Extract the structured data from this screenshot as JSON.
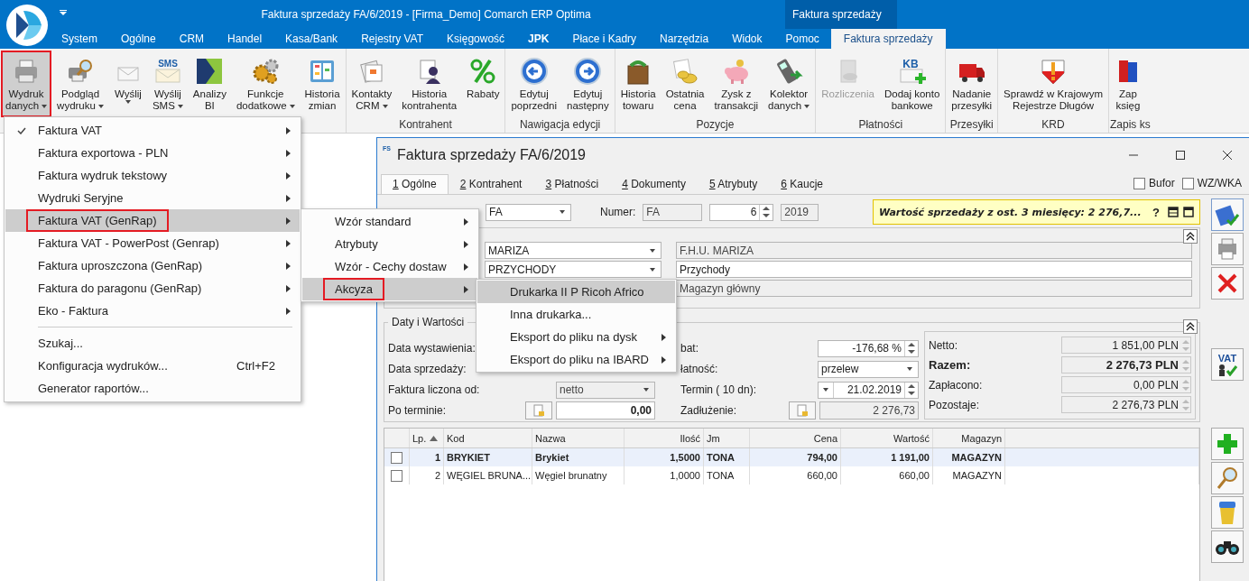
{
  "app": {
    "title": "Faktura sprzedaży FA/6/2019 - [Firma_Demo] Comarch ERP Optima",
    "context_header": "Faktura sprzedaży"
  },
  "menu_tabs": [
    {
      "label": "System",
      "selected": false,
      "bold": false
    },
    {
      "label": "Ogólne",
      "selected": false,
      "bold": false
    },
    {
      "label": "CRM",
      "selected": false,
      "bold": false
    },
    {
      "label": "Handel",
      "selected": false,
      "bold": false
    },
    {
      "label": "Kasa/Bank",
      "selected": false,
      "bold": false
    },
    {
      "label": "Rejestry VAT",
      "selected": false,
      "bold": false
    },
    {
      "label": "Księgowość",
      "selected": false,
      "bold": false
    },
    {
      "label": "JPK",
      "selected": false,
      "bold": true
    },
    {
      "label": "Płace i Kadry",
      "selected": false,
      "bold": false
    },
    {
      "label": "Narzędzia",
      "selected": false,
      "bold": false
    },
    {
      "label": "Widok",
      "selected": false,
      "bold": false
    },
    {
      "label": "Pomoc",
      "selected": false,
      "bold": false
    },
    {
      "label": "Faktura sprzedaży",
      "selected": true,
      "bold": false
    }
  ],
  "ribbon_groups": [
    {
      "buttons": [
        {
          "lines": [
            "Wydruk",
            "danych"
          ],
          "dropdown": true,
          "pressed": true,
          "marked": true,
          "disabled": false
        },
        {
          "lines": [
            "Podgląd",
            "wydruku"
          ],
          "dropdown": true,
          "pressed": false,
          "marked": false,
          "disabled": false
        },
        {
          "lines": [
            "Wyślij"
          ],
          "dropdown": true,
          "pressed": false,
          "marked": false,
          "disabled": false
        },
        {
          "lines": [
            "Wyślij",
            "SMS"
          ],
          "dropdown": true,
          "pressed": false,
          "marked": false,
          "disabled": false,
          "icon_text": "SMS"
        },
        {
          "lines": [
            "Analizy",
            "BI"
          ],
          "dropdown": false,
          "pressed": false,
          "marked": false,
          "disabled": false
        },
        {
          "lines": [
            "Funkcje",
            "dodatkowe"
          ],
          "dropdown": true,
          "pressed": false,
          "marked": false,
          "disabled": false
        },
        {
          "lines": [
            "Historia",
            "zmian"
          ],
          "dropdown": false,
          "pressed": false,
          "marked": false,
          "disabled": false
        }
      ]
    },
    {
      "label": "Kontrahent",
      "buttons": [
        {
          "lines": [
            "Kontakty",
            "CRM"
          ],
          "dropdown": true,
          "pressed": false,
          "marked": false,
          "disabled": false
        },
        {
          "lines": [
            "Historia",
            "kontrahenta"
          ],
          "dropdown": false,
          "pressed": false,
          "marked": false,
          "disabled": false
        },
        {
          "lines": [
            "Rabaty"
          ],
          "dropdown": false,
          "pressed": false,
          "marked": false,
          "disabled": false
        }
      ]
    },
    {
      "label": "Nawigacja edycji",
      "buttons": [
        {
          "lines": [
            "Edytuj",
            "poprzedni"
          ],
          "dropdown": false,
          "pressed": false,
          "marked": false,
          "disabled": false
        },
        {
          "lines": [
            "Edytuj",
            "następny"
          ],
          "dropdown": false,
          "pressed": false,
          "marked": false,
          "disabled": false
        }
      ]
    },
    {
      "label": "Pozycje",
      "buttons": [
        {
          "lines": [
            "Historia",
            "towaru"
          ],
          "dropdown": false,
          "pressed": false,
          "marked": false,
          "disabled": false
        },
        {
          "lines": [
            "Ostatnia",
            "cena"
          ],
          "dropdown": false,
          "pressed": false,
          "marked": false,
          "disabled": false
        },
        {
          "lines": [
            "Zysk z",
            "transakcji"
          ],
          "dropdown": false,
          "pressed": false,
          "marked": false,
          "disabled": false
        },
        {
          "lines": [
            "Kolektor",
            "danych"
          ],
          "dropdown": true,
          "pressed": false,
          "marked": false,
          "disabled": false
        }
      ]
    },
    {
      "label": "Płatności",
      "buttons": [
        {
          "lines": [
            "Rozliczenia"
          ],
          "dropdown": false,
          "pressed": false,
          "marked": false,
          "disabled": true
        },
        {
          "lines": [
            "Dodaj konto",
            "bankowe"
          ],
          "dropdown": false,
          "pressed": false,
          "marked": false,
          "disabled": false,
          "icon_text": "KB"
        }
      ]
    },
    {
      "label": "Przesyłki",
      "buttons": [
        {
          "lines": [
            "Nadanie",
            "przesyłki"
          ],
          "dropdown": false,
          "pressed": false,
          "marked": false,
          "disabled": false
        }
      ]
    },
    {
      "label": "KRD",
      "buttons": [
        {
          "lines": [
            "Sprawdź w Krajowym",
            "Rejestrze Długów"
          ],
          "dropdown": false,
          "pressed": false,
          "marked": false,
          "disabled": false
        }
      ]
    },
    {
      "label": "Zapis ks",
      "buttons": [
        {
          "lines": [
            "Zap",
            "księg"
          ],
          "dropdown": false,
          "pressed": false,
          "marked": false,
          "disabled": false
        }
      ]
    }
  ],
  "print_menu": [
    {
      "kind": "item",
      "label": "Faktura VAT",
      "checked": true,
      "arrow": true,
      "selected": false,
      "marked": false
    },
    {
      "kind": "item",
      "label": "Faktura exportowa - PLN",
      "checked": false,
      "arrow": true,
      "selected": false,
      "marked": false
    },
    {
      "kind": "item",
      "label": "Faktura wydruk tekstowy",
      "checked": false,
      "arrow": true,
      "selected": false,
      "marked": false
    },
    {
      "kind": "item",
      "label": "Wydruki Seryjne",
      "checked": false,
      "arrow": true,
      "selected": false,
      "marked": false
    },
    {
      "kind": "item",
      "label": "Faktura VAT (GenRap)",
      "checked": false,
      "arrow": true,
      "selected": true,
      "marked": true
    },
    {
      "kind": "item",
      "label": "Faktura VAT - PowerPost (Genrap)",
      "checked": false,
      "arrow": true,
      "selected": false,
      "marked": false
    },
    {
      "kind": "item",
      "label": "Faktura uproszczona (GenRap)",
      "checked": false,
      "arrow": true,
      "selected": false,
      "marked": false
    },
    {
      "kind": "item",
      "label": "Faktura do paragonu (GenRap)",
      "checked": false,
      "arrow": true,
      "selected": false,
      "marked": false
    },
    {
      "kind": "item",
      "label": "Eko - Faktura",
      "checked": false,
      "arrow": true,
      "selected": false,
      "marked": false
    },
    {
      "kind": "separator"
    },
    {
      "kind": "item",
      "label": "Szukaj...",
      "checked": false,
      "arrow": false,
      "selected": false,
      "marked": false
    },
    {
      "kind": "item",
      "label": "Konfiguracja wydruków...",
      "shortcut": "Ctrl+F2",
      "checked": false,
      "arrow": false,
      "selected": false,
      "marked": false
    },
    {
      "kind": "item",
      "label": "Generator raportów...",
      "checked": false,
      "arrow": false,
      "selected": false,
      "marked": false
    }
  ],
  "submenu": [
    {
      "label": "Wzór standard",
      "arrow": true,
      "selected": false,
      "marked": false
    },
    {
      "label": "Atrybuty",
      "arrow": true,
      "selected": false,
      "marked": false
    },
    {
      "label": "Wzór - Cechy dostaw",
      "arrow": true,
      "selected": false,
      "marked": false
    },
    {
      "label": "Akcyza",
      "arrow": true,
      "selected": true,
      "marked": true
    }
  ],
  "submenu_2": [
    {
      "label": "Drukarka II P Ricoh Africo",
      "arrow": false,
      "selected": true
    },
    {
      "label": "Inna drukarka...",
      "arrow": false,
      "selected": false
    },
    {
      "label": "Eksport do pliku na dysk",
      "arrow": true,
      "selected": false
    },
    {
      "label": "Eksport do pliku na IBARD",
      "arrow": true,
      "selected": false
    }
  ],
  "document": {
    "icon_text": "FS",
    "title": "Faktura sprzedaży FA/6/2019",
    "tabs": [
      {
        "key": "1",
        "label": "Ogólne",
        "selected": true
      },
      {
        "key": "2",
        "label": "Kontrahent",
        "selected": false
      },
      {
        "key": "3",
        "label": "Płatności",
        "selected": false
      },
      {
        "key": "4",
        "label": "Dokumenty",
        "selected": false
      },
      {
        "key": "5",
        "label": "Atrybuty",
        "selected": false
      },
      {
        "key": "6",
        "label": "Kaucje",
        "selected": false
      }
    ],
    "options": [
      {
        "label": "Bufor",
        "checked": false
      },
      {
        "label": "WZ/WKA",
        "checked": false
      }
    ],
    "header": {
      "document_type": "FA",
      "number_label": "Numer:",
      "series": "FA",
      "number": "6",
      "year": "2019",
      "info": "Wartość sprzedaży z ost. 3 miesięcy: 2 276,7...",
      "info_help": "?"
    },
    "parties": [
      {
        "code": "MARIZA",
        "name": "F.H.U. MARIZA",
        "name_disabled": true
      },
      {
        "code": "PRZYCHODY",
        "name": "Przychody",
        "name_disabled": false
      },
      {
        "name": "Magazyn główny",
        "name_disabled": true
      }
    ],
    "dates_group": {
      "title": "Daty i Wartości",
      "left": [
        {
          "kind": "label",
          "label": "Data wystawienia:"
        },
        {
          "kind": "label",
          "label": "Data sprzedaży:"
        },
        {
          "kind": "combo",
          "label": "Faktura liczona od:",
          "value": "netto",
          "disabled": true
        },
        {
          "kind": "button-field",
          "label": "Po terminie:",
          "value": "0,00",
          "disabled": false
        }
      ],
      "middle": [
        {
          "kind": "spin",
          "label": "bat:",
          "value": "-176,68 %"
        },
        {
          "kind": "combo",
          "label": "łatność:",
          "value": "przelew",
          "disabled": false
        },
        {
          "kind": "date",
          "label": "Termin (  10 dn):",
          "value": "21.02.2019"
        },
        {
          "kind": "button-field",
          "label": "Zadłużenie:",
          "value": "2 276,73",
          "disabled": true
        }
      ],
      "totals": [
        {
          "kind": "normal",
          "label": "Netto:",
          "value": "1 851,00 PLN"
        },
        {
          "kind": "total",
          "label": "Razem:",
          "value": "2 276,73 PLN"
        },
        {
          "kind": "normal",
          "label": "Zapłacono:",
          "value": "0,00 PLN"
        },
        {
          "kind": "normal",
          "label": "Pozostaje:",
          "value": "2 276,73 PLN"
        }
      ]
    },
    "table": {
      "columns": [
        {
          "label": "Lp.",
          "sorted": true
        },
        {
          "label": "Kod",
          "sorted": false
        },
        {
          "label": "Nazwa",
          "sorted": false
        },
        {
          "label": "Ilość",
          "sorted": false
        },
        {
          "label": "Jm",
          "sorted": false
        },
        {
          "label": "Cena",
          "sorted": false
        },
        {
          "label": "Wartość",
          "sorted": false
        },
        {
          "label": "Magazyn",
          "sorted": false
        }
      ],
      "rows": [
        {
          "checked": false,
          "selected": true,
          "cells": [
            "1",
            "BRYKIET",
            "Brykiet",
            "1,5000",
            "TONA",
            "794,00",
            "1 191,00",
            "MAGAZYN"
          ]
        },
        {
          "checked": false,
          "selected": false,
          "cells": [
            "2",
            "WĘGIEL BRUNA...",
            "Węgiel brunatny",
            "1,0000",
            "TONA",
            "660,00",
            "660,00",
            "MAGAZYN"
          ]
        }
      ]
    },
    "side_toolbar": {
      "vat_label": "VAT"
    }
  }
}
